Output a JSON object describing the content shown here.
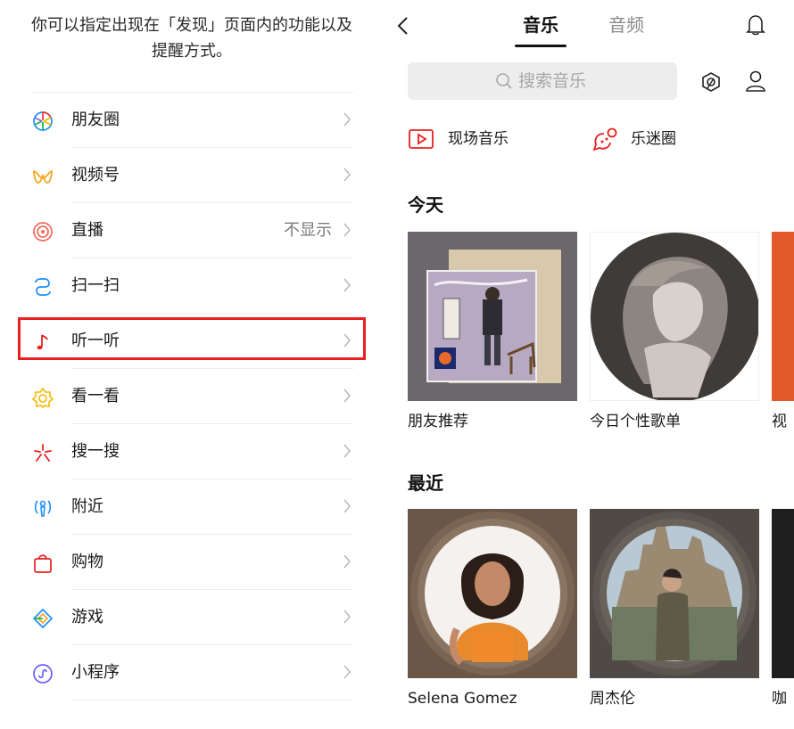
{
  "left": {
    "description": "你可以指定出现在「发现」页面内的功能以及提醒方式。",
    "items": [
      {
        "label": "朋友圈",
        "value": ""
      },
      {
        "label": "视频号",
        "value": ""
      },
      {
        "label": "直播",
        "value": "不显示"
      },
      {
        "label": "扫一扫",
        "value": ""
      },
      {
        "label": "听一听",
        "value": ""
      },
      {
        "label": "看一看",
        "value": ""
      },
      {
        "label": "搜一搜",
        "value": ""
      },
      {
        "label": "附近",
        "value": ""
      },
      {
        "label": "购物",
        "value": ""
      },
      {
        "label": "游戏",
        "value": ""
      },
      {
        "label": "小程序",
        "value": ""
      }
    ]
  },
  "right": {
    "tabs": [
      "音乐",
      "音频"
    ],
    "active_tab": "音乐",
    "search_placeholder": "搜索音乐",
    "quick_links": [
      "现场音乐",
      "乐迷圈"
    ],
    "sections": {
      "today": {
        "title": "今天",
        "cards": [
          "朋友推荐",
          "今日个性歌单",
          "视"
        ]
      },
      "recent": {
        "title": "最近",
        "cards": [
          "Selena Gomez",
          "周杰伦",
          "咖"
        ]
      }
    }
  },
  "colors": {
    "highlight_border": "#e8201f",
    "active_text": "#111111",
    "inactive_text": "#8a8a8a",
    "search_bg": "#ededed"
  }
}
